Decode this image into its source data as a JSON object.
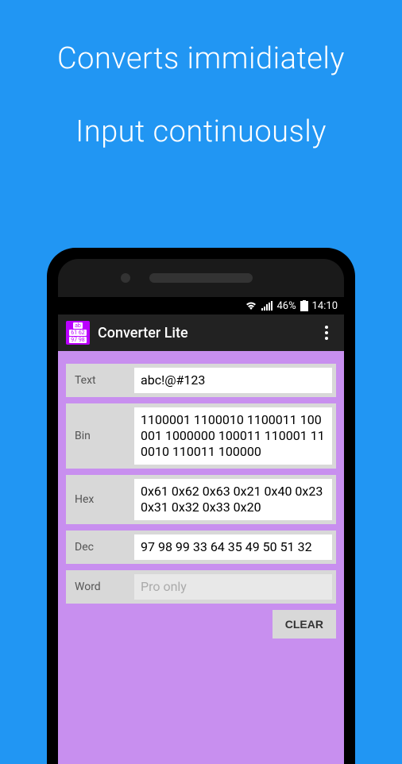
{
  "promo": {
    "line1": "Converts immidiately",
    "line2": "Input continuously"
  },
  "statusbar": {
    "battery_pct": "46%",
    "time": "14:10"
  },
  "app": {
    "title": "Converter Lite",
    "icon_lines": [
      "ab",
      "61 62",
      "97 98"
    ]
  },
  "rows": {
    "text": {
      "label": "Text",
      "value": "abc!@#123"
    },
    "bin": {
      "label": "Bin",
      "value": "1100001 1100010 1100011 100001 1000000 100011 110001 110010 110011 100000"
    },
    "hex": {
      "label": "Hex",
      "value": "0x61 0x62 0x63 0x21 0x40 0x23 0x31 0x32 0x33 0x20"
    },
    "dec": {
      "label": "Dec",
      "value": "97 98 99 33 64 35 49 50 51 32"
    },
    "word": {
      "label": "Word",
      "placeholder": "Pro only"
    }
  },
  "buttons": {
    "clear": "CLEAR"
  }
}
